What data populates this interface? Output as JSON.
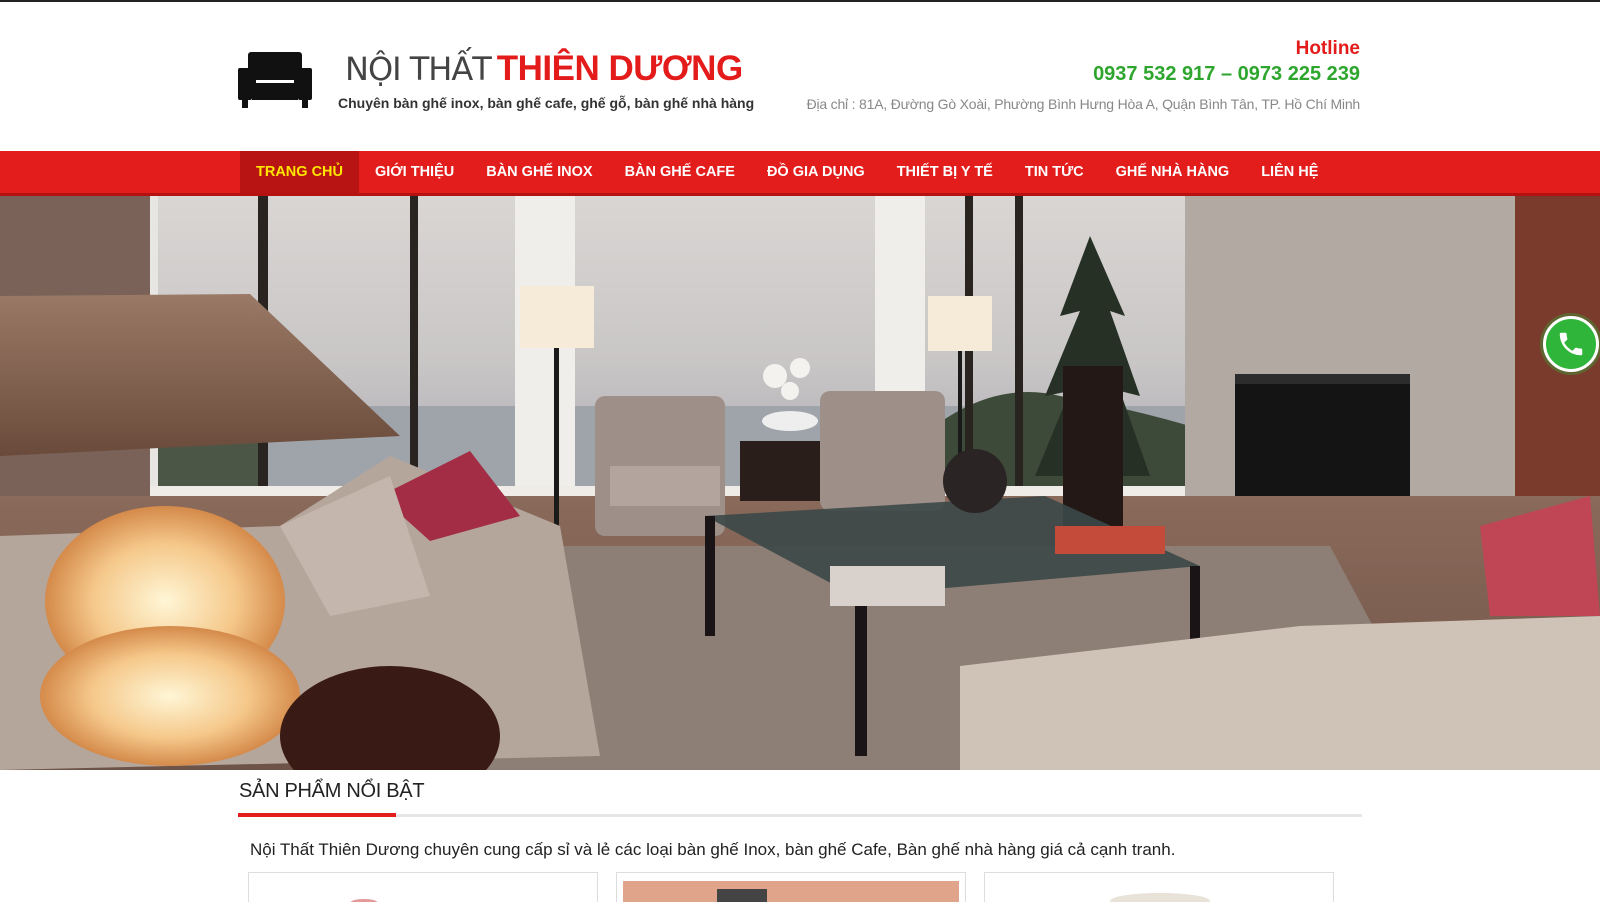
{
  "header": {
    "brand_light": "NỘI THẤT",
    "brand_bold": "THIÊN DƯƠNG",
    "slogan": "Chuyên bàn ghế inox, bàn ghế cafe, ghế gỗ, bàn ghế nhà hàng",
    "hotline_label": "Hotline",
    "hotline_numbers": "0937 532 917 – 0973 225 239",
    "address": "Địa chỉ : 81A, Đường Gò Xoài, Phường Bình Hưng Hòa A, Quận Bình Tân, TP. Hồ Chí Minh",
    "logo_icon": "sofa-icon"
  },
  "nav": {
    "items": [
      {
        "label": "TRANG CHỦ",
        "active": true
      },
      {
        "label": "GIỚI THIỆU"
      },
      {
        "label": "BÀN GHẾ INOX"
      },
      {
        "label": "BÀN GHẾ CAFE"
      },
      {
        "label": "ĐỒ GIA DỤNG"
      },
      {
        "label": "THIẾT BỊ Y TẾ"
      },
      {
        "label": "TIN TỨC"
      },
      {
        "label": "GHẾ NHÀ HÀNG"
      },
      {
        "label": "LIÊN HỆ"
      }
    ]
  },
  "hero": {
    "image": "living-room-photo"
  },
  "call_button": {
    "icon": "phone-icon"
  },
  "featured": {
    "title": "SẢN PHẨM NỔI BẬT",
    "description": "Nội Thất Thiên Dương chuyên cung cấp sỉ và lẻ các loại bàn ghế Inox, bàn ghế Cafe, Bàn ghế nhà hàng giá cả cạnh tranh."
  },
  "colors": {
    "primary_red": "#e31c1c",
    "active_nav_bg": "#b81414",
    "active_nav_text": "#ffe600",
    "hotline_green": "#2ea62e"
  }
}
